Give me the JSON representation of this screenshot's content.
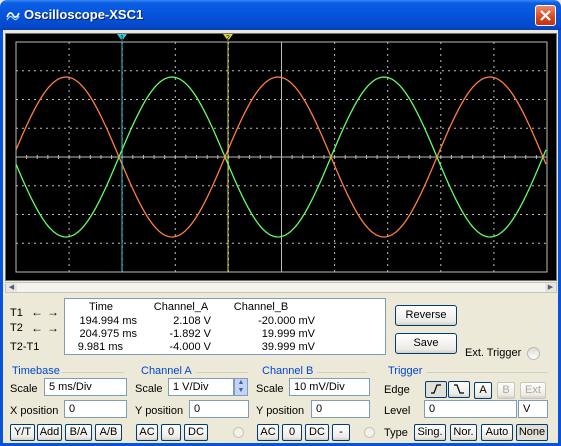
{
  "window": {
    "title": "Oscilloscope-XSC1",
    "accent": "#0653dc",
    "close_icon": "close-icon",
    "app_icon": "oscilloscope-icon"
  },
  "screen": {
    "background": "#000000",
    "trace_a_color": "#ff7f3f",
    "trace_b_color": "#66ff66",
    "grid_color": "#bdbdbd",
    "cursor1_color": "#33ccdd",
    "cursor2_color": "#d8d84a",
    "cursor_label_1": "1",
    "cursor_label_2": "2"
  },
  "readout": {
    "headers": {
      "time": "Time",
      "a": "Channel_A",
      "b": "Channel_B"
    },
    "rows": [
      {
        "label": "T1",
        "time": "194.994 ms",
        "a": "2.108 V",
        "b": "-20.000 mV"
      },
      {
        "label": "T2",
        "time": "204.975 ms",
        "a": "-1.892 V",
        "b": "19.999 mV"
      },
      {
        "label": "T2-T1",
        "time": "9.981 ms",
        "a": "-4.000 V",
        "b": "39.999 mV"
      }
    ]
  },
  "buttons": {
    "reverse": "Reverse",
    "save": "Save",
    "ext_trigger": "Ext. Trigger"
  },
  "timebase": {
    "title": "Timebase",
    "scale_label": "Scale",
    "scale_value": "5 ms/Div",
    "xpos_label": "X position",
    "xpos_value": "0",
    "modes": [
      "Y/T",
      "Add",
      "B/A",
      "A/B"
    ]
  },
  "channel_a": {
    "title": "Channel A",
    "scale_label": "Scale",
    "scale_value": "1  V/Div",
    "ypos_label": "Y position",
    "ypos_value": "0",
    "coupling": [
      "AC",
      "0",
      "DC"
    ]
  },
  "channel_b": {
    "title": "Channel B",
    "scale_label": "Scale",
    "scale_value": "10 mV/Div",
    "ypos_label": "Y position",
    "ypos_value": "0",
    "coupling": [
      "AC",
      "0",
      "DC",
      "-"
    ]
  },
  "trigger": {
    "title": "Trigger",
    "edge_label": "Edge",
    "edge_rising_icon": "rising-edge-icon",
    "edge_falling_icon": "falling-edge-icon",
    "sources": [
      "A",
      "B",
      "Ext"
    ],
    "level_label": "Level",
    "level_value": "0",
    "level_unit": "V",
    "type_label": "Type",
    "types": [
      "Sing.",
      "Nor.",
      "Auto",
      "None"
    ]
  }
}
